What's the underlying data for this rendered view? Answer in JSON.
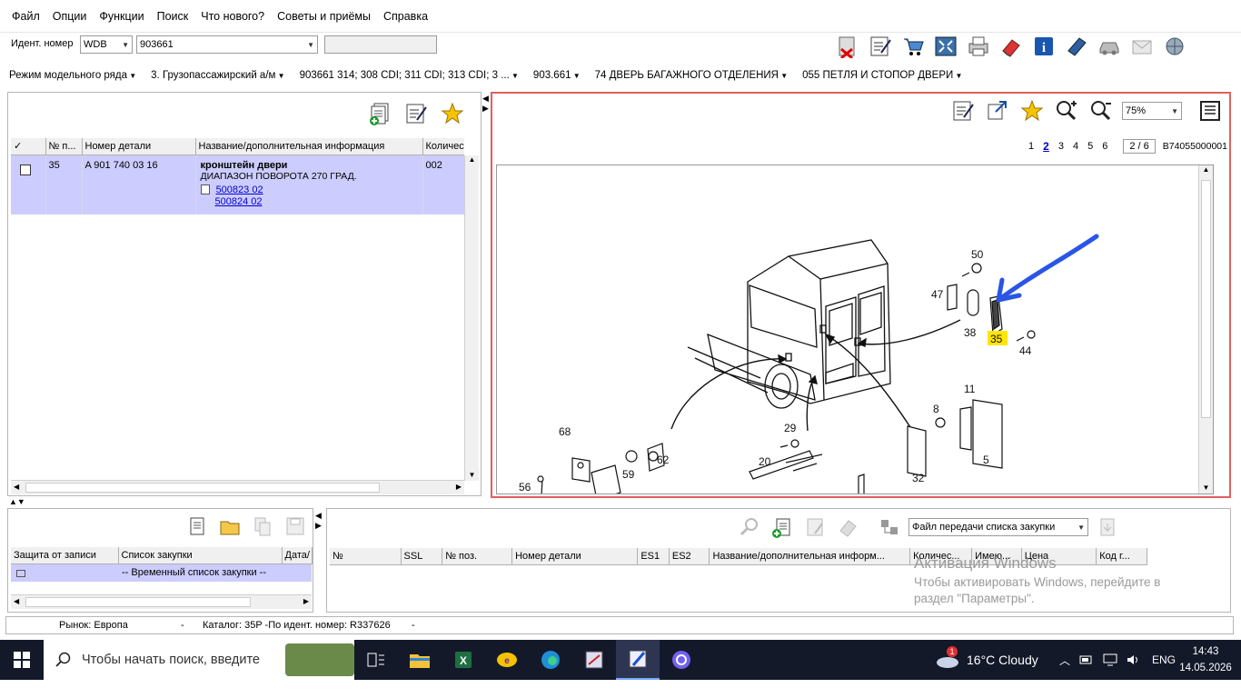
{
  "menu": [
    "Файл",
    "Опции",
    "Функции",
    "Поиск",
    "Что нового?",
    "Советы и приёмы",
    "Справка"
  ],
  "ident": {
    "label": "Идент. номер",
    "prefix": "WDB",
    "number": "903661",
    "extra": ""
  },
  "toolbar_icons": [
    "delete-icon",
    "edit-list-icon",
    "cart-icon",
    "fullscreen-icon",
    "print-icon",
    "eraser-icon",
    "info-icon",
    "book-icon",
    "car-icon",
    "mail-icon",
    "globe-icon"
  ],
  "breadcrumbs": [
    "Режим модельного ряда",
    "3. Грузопассажирский а/м",
    "903661 314; 308 CDI; 311 CDI; 313 CDI; 3 ...",
    "903.661",
    "74 ДВЕРЬ БАГАЖНОГО ОТДЕЛЕНИЯ",
    "055 ПЕТЛЯ И СТОПОР ДВЕРИ"
  ],
  "parts_table": {
    "headers": [
      "✓",
      "№ п...",
      "Номер детали",
      "Название/дополнительная информация",
      "Количес"
    ],
    "rows": [
      {
        "pos": "35",
        "part": "A 901 740 03 16",
        "name": "кронштейн двери",
        "info": "ДИАПАЗОН ПОВОРОТА 270 ГРАД.",
        "links": [
          "500823 02",
          "500824 02"
        ],
        "qty": "002"
      }
    ]
  },
  "viewer": {
    "zoom": "75%",
    "pages": [
      "1",
      "2",
      "3",
      "4",
      "5",
      "6"
    ],
    "current_page": "2",
    "page_of": "2 / 6",
    "drawing_id": "B74055000001",
    "callouts": [
      "50",
      "47",
      "38",
      "35",
      "44",
      "11",
      "8",
      "5",
      "32",
      "29",
      "20",
      "68",
      "62",
      "59",
      "56"
    ]
  },
  "shopping": {
    "headers": [
      "Защита от записи",
      "Список закупки",
      "Дата/"
    ],
    "rows": [
      {
        "list": "-- Временный список закупки --"
      }
    ]
  },
  "transfer": {
    "file_label": "Файл передачи списка закупки",
    "headers": [
      "№",
      "SSL",
      "№ поз.",
      "Номер детали",
      "ES1",
      "ES2",
      "Название/дополнительная информ...",
      "Количес...",
      "Имею...",
      "Цена",
      "Код г..."
    ]
  },
  "watermark": {
    "title": "Активация Windows",
    "line1": "Чтобы активировать Windows, перейдите в",
    "line2": "раздел \"Параметры\"."
  },
  "status": {
    "market": "Рынок: Европа",
    "dash1": "-",
    "catalog": "Каталог: 35P -По идент. номер: R337626",
    "dash2": "-"
  },
  "taskbar": {
    "search": "Чтобы начать поиск, введите",
    "weather": "16°C  Cloudy",
    "lang": "ENG",
    "time": "14:43",
    "date": "14.05.2026",
    "badge": "1"
  }
}
